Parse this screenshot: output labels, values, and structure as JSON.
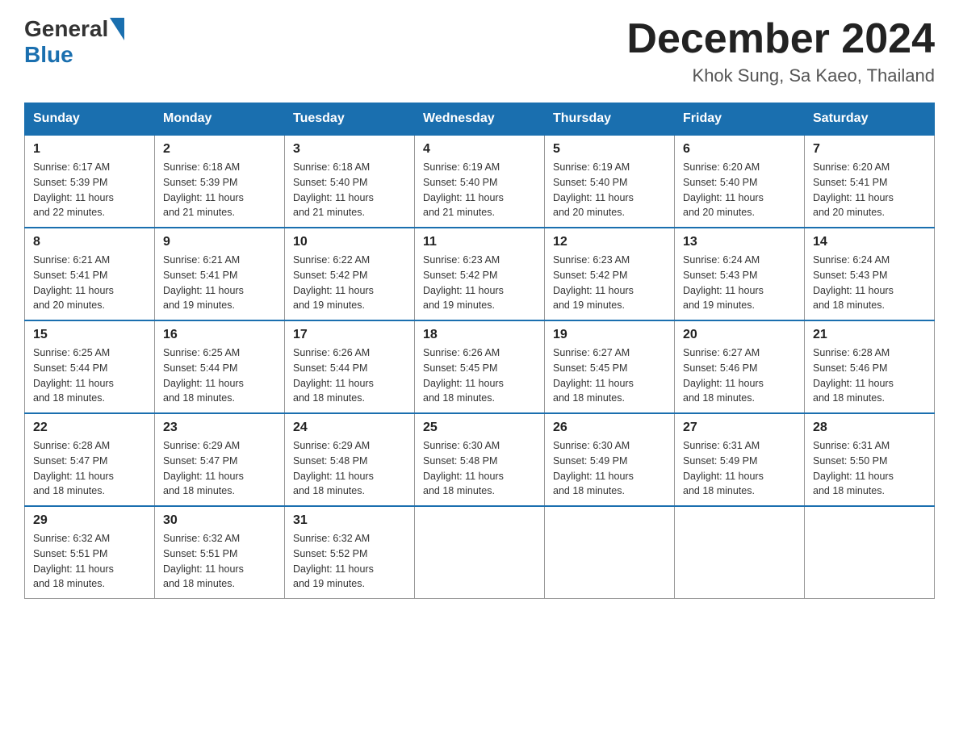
{
  "logo": {
    "general": "General",
    "blue": "Blue"
  },
  "header": {
    "month_year": "December 2024",
    "location": "Khok Sung, Sa Kaeo, Thailand"
  },
  "days_of_week": [
    "Sunday",
    "Monday",
    "Tuesday",
    "Wednesday",
    "Thursday",
    "Friday",
    "Saturday"
  ],
  "weeks": [
    [
      {
        "day": "1",
        "sunrise": "6:17 AM",
        "sunset": "5:39 PM",
        "daylight": "11 hours and 22 minutes."
      },
      {
        "day": "2",
        "sunrise": "6:18 AM",
        "sunset": "5:39 PM",
        "daylight": "11 hours and 21 minutes."
      },
      {
        "day": "3",
        "sunrise": "6:18 AM",
        "sunset": "5:40 PM",
        "daylight": "11 hours and 21 minutes."
      },
      {
        "day": "4",
        "sunrise": "6:19 AM",
        "sunset": "5:40 PM",
        "daylight": "11 hours and 21 minutes."
      },
      {
        "day": "5",
        "sunrise": "6:19 AM",
        "sunset": "5:40 PM",
        "daylight": "11 hours and 20 minutes."
      },
      {
        "day": "6",
        "sunrise": "6:20 AM",
        "sunset": "5:40 PM",
        "daylight": "11 hours and 20 minutes."
      },
      {
        "day": "7",
        "sunrise": "6:20 AM",
        "sunset": "5:41 PM",
        "daylight": "11 hours and 20 minutes."
      }
    ],
    [
      {
        "day": "8",
        "sunrise": "6:21 AM",
        "sunset": "5:41 PM",
        "daylight": "11 hours and 20 minutes."
      },
      {
        "day": "9",
        "sunrise": "6:21 AM",
        "sunset": "5:41 PM",
        "daylight": "11 hours and 19 minutes."
      },
      {
        "day": "10",
        "sunrise": "6:22 AM",
        "sunset": "5:42 PM",
        "daylight": "11 hours and 19 minutes."
      },
      {
        "day": "11",
        "sunrise": "6:23 AM",
        "sunset": "5:42 PM",
        "daylight": "11 hours and 19 minutes."
      },
      {
        "day": "12",
        "sunrise": "6:23 AM",
        "sunset": "5:42 PM",
        "daylight": "11 hours and 19 minutes."
      },
      {
        "day": "13",
        "sunrise": "6:24 AM",
        "sunset": "5:43 PM",
        "daylight": "11 hours and 19 minutes."
      },
      {
        "day": "14",
        "sunrise": "6:24 AM",
        "sunset": "5:43 PM",
        "daylight": "11 hours and 18 minutes."
      }
    ],
    [
      {
        "day": "15",
        "sunrise": "6:25 AM",
        "sunset": "5:44 PM",
        "daylight": "11 hours and 18 minutes."
      },
      {
        "day": "16",
        "sunrise": "6:25 AM",
        "sunset": "5:44 PM",
        "daylight": "11 hours and 18 minutes."
      },
      {
        "day": "17",
        "sunrise": "6:26 AM",
        "sunset": "5:44 PM",
        "daylight": "11 hours and 18 minutes."
      },
      {
        "day": "18",
        "sunrise": "6:26 AM",
        "sunset": "5:45 PM",
        "daylight": "11 hours and 18 minutes."
      },
      {
        "day": "19",
        "sunrise": "6:27 AM",
        "sunset": "5:45 PM",
        "daylight": "11 hours and 18 minutes."
      },
      {
        "day": "20",
        "sunrise": "6:27 AM",
        "sunset": "5:46 PM",
        "daylight": "11 hours and 18 minutes."
      },
      {
        "day": "21",
        "sunrise": "6:28 AM",
        "sunset": "5:46 PM",
        "daylight": "11 hours and 18 minutes."
      }
    ],
    [
      {
        "day": "22",
        "sunrise": "6:28 AM",
        "sunset": "5:47 PM",
        "daylight": "11 hours and 18 minutes."
      },
      {
        "day": "23",
        "sunrise": "6:29 AM",
        "sunset": "5:47 PM",
        "daylight": "11 hours and 18 minutes."
      },
      {
        "day": "24",
        "sunrise": "6:29 AM",
        "sunset": "5:48 PM",
        "daylight": "11 hours and 18 minutes."
      },
      {
        "day": "25",
        "sunrise": "6:30 AM",
        "sunset": "5:48 PM",
        "daylight": "11 hours and 18 minutes."
      },
      {
        "day": "26",
        "sunrise": "6:30 AM",
        "sunset": "5:49 PM",
        "daylight": "11 hours and 18 minutes."
      },
      {
        "day": "27",
        "sunrise": "6:31 AM",
        "sunset": "5:49 PM",
        "daylight": "11 hours and 18 minutes."
      },
      {
        "day": "28",
        "sunrise": "6:31 AM",
        "sunset": "5:50 PM",
        "daylight": "11 hours and 18 minutes."
      }
    ],
    [
      {
        "day": "29",
        "sunrise": "6:32 AM",
        "sunset": "5:51 PM",
        "daylight": "11 hours and 18 minutes."
      },
      {
        "day": "30",
        "sunrise": "6:32 AM",
        "sunset": "5:51 PM",
        "daylight": "11 hours and 18 minutes."
      },
      {
        "day": "31",
        "sunrise": "6:32 AM",
        "sunset": "5:52 PM",
        "daylight": "11 hours and 19 minutes."
      },
      null,
      null,
      null,
      null
    ]
  ]
}
